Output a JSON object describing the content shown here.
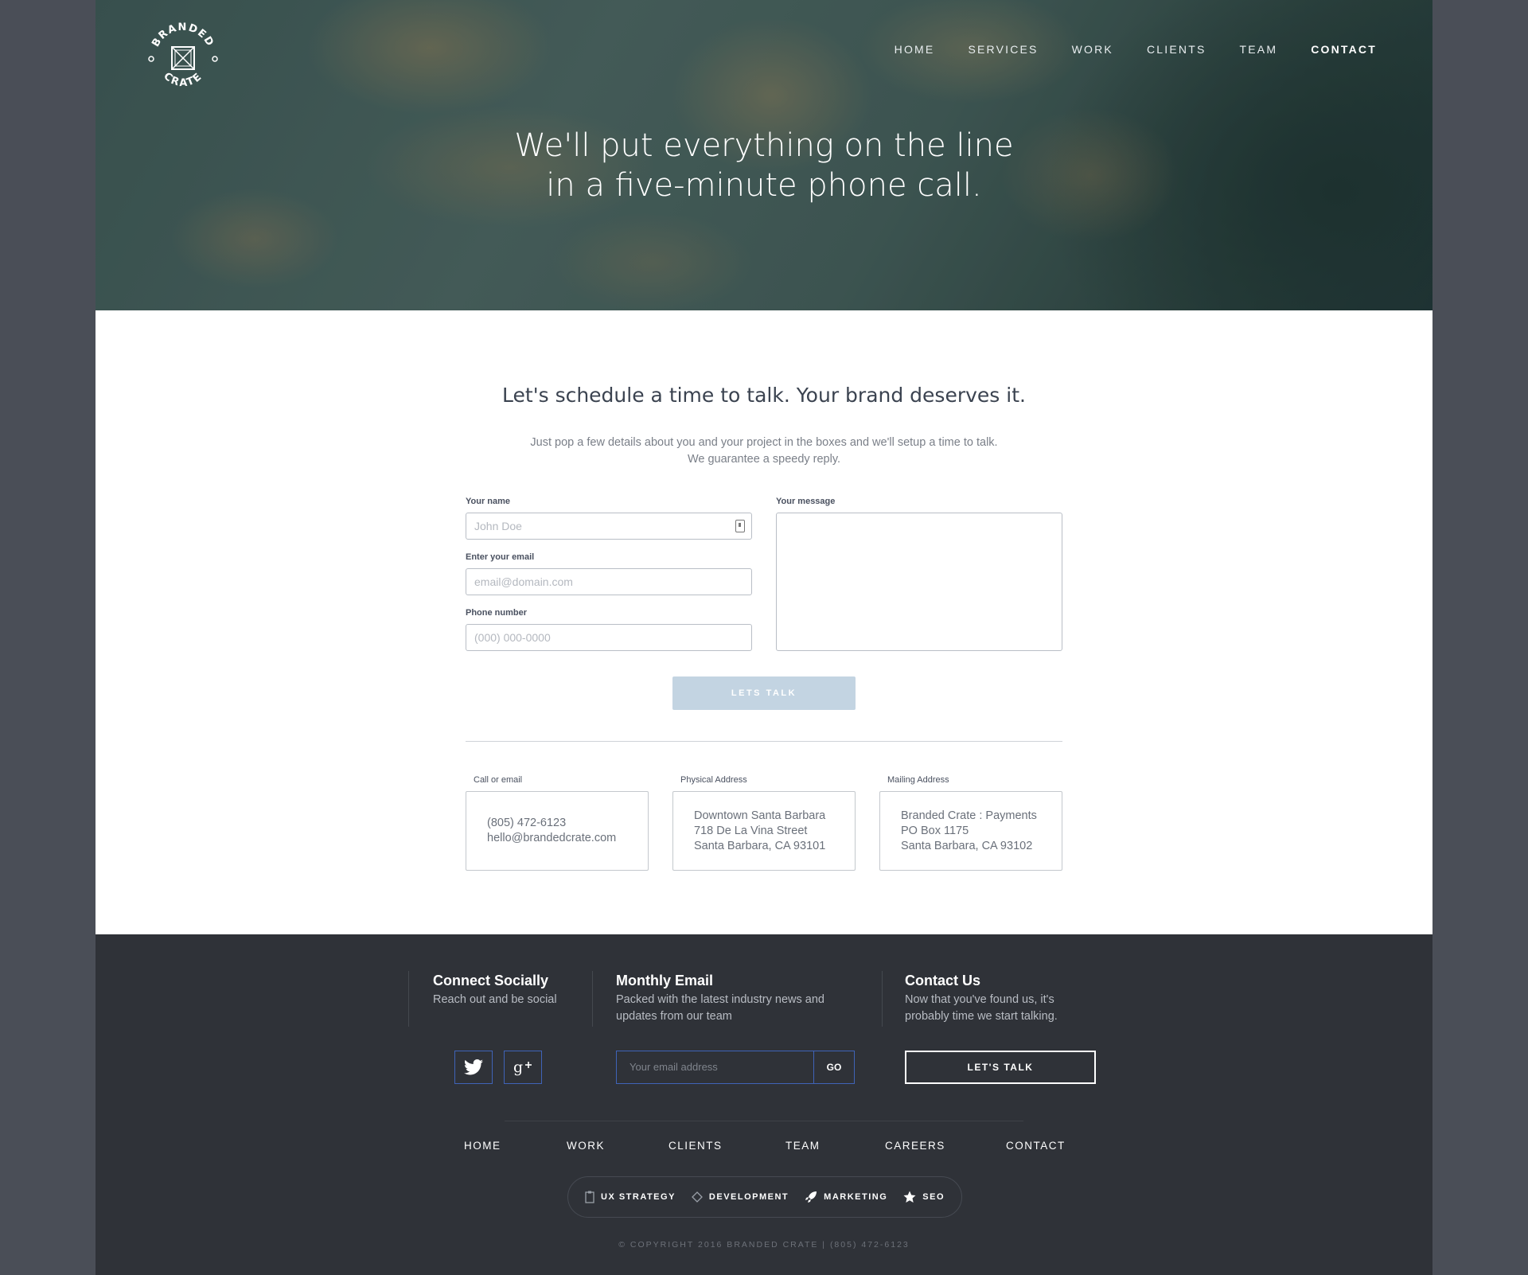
{
  "nav": {
    "items": [
      {
        "label": "HOME"
      },
      {
        "label": "SERVICES"
      },
      {
        "label": "WORK"
      },
      {
        "label": "CLIENTS"
      },
      {
        "label": "TEAM"
      },
      {
        "label": "CONTACT",
        "active": true
      }
    ]
  },
  "logo": {
    "top_text": "BRANDED",
    "bottom_text": "CRATE"
  },
  "hero": {
    "line1": "We'll put everything on the line",
    "line2": "in a five-minute phone call."
  },
  "content": {
    "heading": "Let's schedule a time to talk. Your brand deserves it.",
    "intro_line1": "Just pop a few details about you and your project in the boxes and we'll setup a time to talk.",
    "intro_line2": "We guarantee a speedy reply."
  },
  "form": {
    "name_label": "Your name",
    "name_placeholder": "John Doe",
    "email_label": "Enter your email",
    "email_placeholder": "email@domain.com",
    "phone_label": "Phone number",
    "phone_placeholder": "(000) 000-0000",
    "message_label": "Your message",
    "submit_label": "LETS TALK"
  },
  "info": {
    "call": {
      "label": "Call or email",
      "line1": "(805) 472-6123",
      "line2": "hello@brandedcrate.com"
    },
    "physical": {
      "label": "Physical Address",
      "line1": "Downtown Santa Barbara",
      "line2": "718 De La Vina Street",
      "line3": "Santa Barbara, CA 93101"
    },
    "mailing": {
      "label": "Mailing Address",
      "line1": "Branded Crate : Payments",
      "line2": "PO Box 1175",
      "line3": "Santa Barbara, CA 93102"
    }
  },
  "footer": {
    "social": {
      "title": "Connect Socially",
      "desc": "Reach out and be social"
    },
    "email": {
      "title": "Monthly Email",
      "desc1": "Packed with the latest industry news and",
      "desc2": "updates from our team",
      "placeholder": "Your email address",
      "go": "GO"
    },
    "contact": {
      "title": "Contact Us",
      "desc1": "Now that you've found us, it's",
      "desc2": "probably time we start talking.",
      "button": "LET'S TALK"
    },
    "nav": [
      "HOME",
      "WORK",
      "CLIENTS",
      "TEAM",
      "CAREERS",
      "CONTACT"
    ],
    "services": [
      "UX STRATEGY",
      "DEVELOPMENT",
      "MARKETING",
      "SEO"
    ],
    "copyright": "© COPYRIGHT 2016 BRANDED CRATE | (805) 472-6123"
  },
  "colors": {
    "accent_blue": "#3f63b8",
    "button_disabled": "#c3d4e2",
    "footer_bg": "#2f3238"
  }
}
